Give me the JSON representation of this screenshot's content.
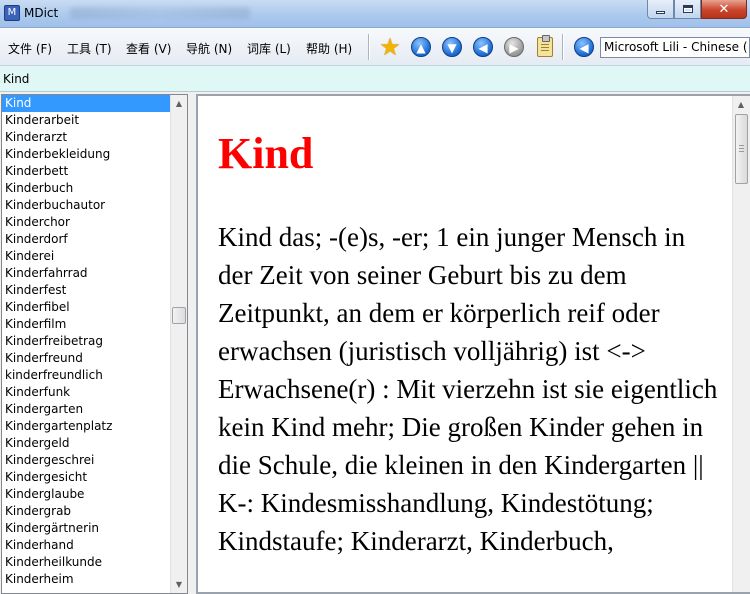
{
  "window": {
    "title": "MDict",
    "app_icon_glyph": "M",
    "close_glyph": "✕"
  },
  "menu": [
    {
      "label": "文件 (F)"
    },
    {
      "label": "工具 (T)"
    },
    {
      "label": "查看 (V)"
    },
    {
      "label": "导航 (N)"
    },
    {
      "label": "词库 (L)"
    },
    {
      "label": "帮助 (H)"
    }
  ],
  "toolbar": {
    "icons": [
      {
        "name": "favorite-star-icon",
        "glyph": "★"
      },
      {
        "name": "up-arrow-icon",
        "glyph": "▲"
      },
      {
        "name": "down-arrow-icon",
        "glyph": "▼"
      },
      {
        "name": "back-arrow-icon",
        "glyph": "◀"
      },
      {
        "name": "forward-arrow-icon",
        "glyph": "▶"
      },
      {
        "name": "clipboard-icon",
        "glyph": ""
      },
      {
        "name": "speaker-icon",
        "glyph": "◀"
      }
    ],
    "voice_value": "Microsoft Lili - Chinese (",
    "colors": {
      "blue": "#1f6fd6",
      "grey": "#9d9d9d",
      "star": "#f2b400"
    }
  },
  "search": {
    "value": "Kind"
  },
  "wordlist": {
    "selected_index": 0,
    "items": [
      "Kind",
      "Kinderarbeit",
      "Kinderarzt",
      "Kinderbekleidung",
      "Kinderbett",
      "Kinderbuch",
      "Kinderbuchautor",
      "Kinderchor",
      "Kinderdorf",
      "Kinderei",
      "Kinderfahrrad",
      "Kinderfest",
      "Kinderfibel",
      "Kinderfilm",
      "Kinderfreibetrag",
      "Kinderfreund",
      "kinderfreundlich",
      "Kinderfunk",
      "Kindergarten",
      "Kindergartenplatz",
      "Kindergeld",
      "Kindergeschrei",
      "Kindergesicht",
      "Kinderglaube",
      "Kindergrab",
      "Kindergärtnerin",
      "Kinderhand",
      "Kinderheilkunde",
      "Kinderheim"
    ],
    "scroll_arrow_up": "▲",
    "scroll_arrow_down": "▼"
  },
  "entry": {
    "headword": "Kind",
    "headword_color": "#ff0000",
    "definition": "Kind das; -(e)s, -er; 1 ein junger Mensch in der Zeit von seiner Geburt bis zu dem Zeitpunkt, an dem er körperlich reif oder erwachsen (juristisch volljährig) ist <-> Erwachsene(r) : Mit vierzehn ist sie eigentlich kein Kind mehr; Die großen Kinder gehen in die Schule, die kleinen in den Kindergarten || K-: Kindesmisshandlung, Kindestötung; Kindstaufe; Kinderarzt, Kinderbuch,"
  }
}
